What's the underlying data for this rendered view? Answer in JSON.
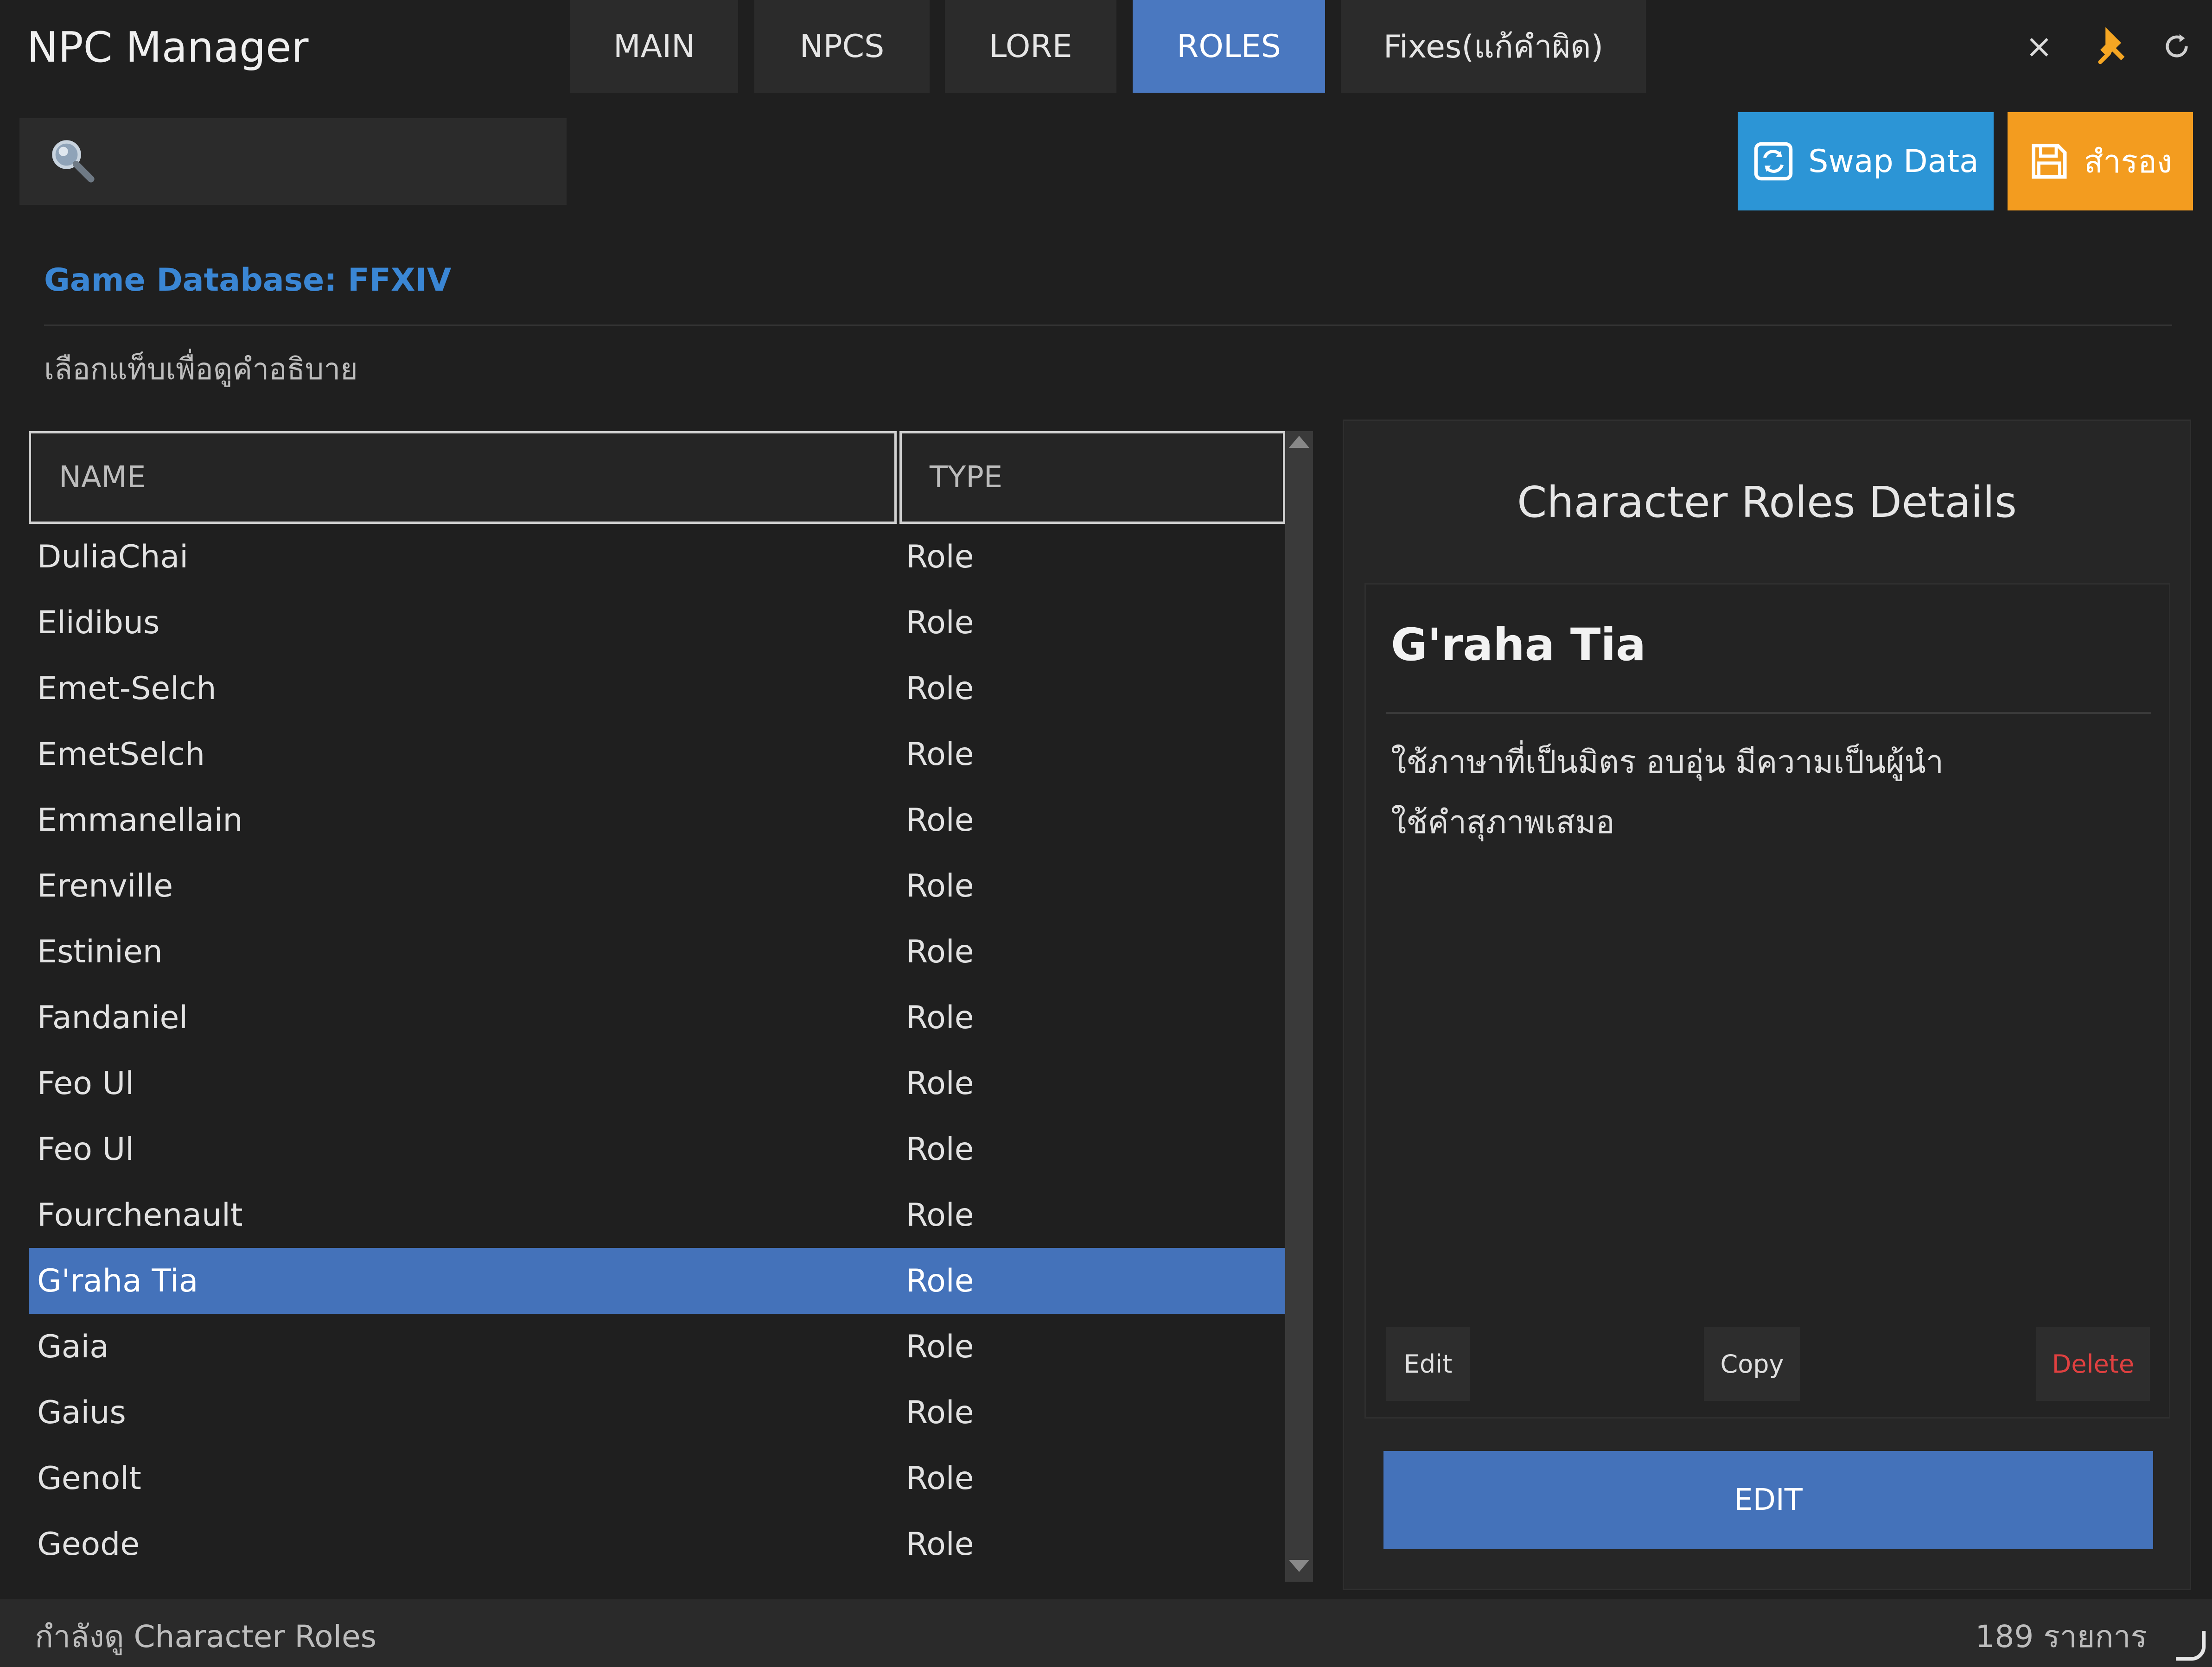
{
  "app": {
    "title": "NPC Manager"
  },
  "tabs": [
    {
      "label": "MAIN",
      "active": false
    },
    {
      "label": "NPCS",
      "active": false
    },
    {
      "label": "LORE",
      "active": false
    },
    {
      "label": "ROLES",
      "active": true
    },
    {
      "label": "Fixes(แก้คำผิด)",
      "active": false
    }
  ],
  "window": {
    "close": "×"
  },
  "search": {
    "placeholder": ""
  },
  "toolbar": {
    "swap_label": "Swap Data",
    "save_label": "สำรอง"
  },
  "database_label": "Game Database: FFXIV",
  "hint_text": "เลือกแท็บเพื่อดูคำอธิบาย",
  "table": {
    "headers": {
      "name": "NAME",
      "type": "TYPE"
    },
    "rows": [
      {
        "name": "DuliaChai",
        "type": "Role"
      },
      {
        "name": "Elidibus",
        "type": "Role"
      },
      {
        "name": "Emet-Selch",
        "type": "Role"
      },
      {
        "name": "EmetSelch",
        "type": "Role"
      },
      {
        "name": "Emmanellain",
        "type": "Role"
      },
      {
        "name": "Erenville",
        "type": "Role"
      },
      {
        "name": "Estinien",
        "type": "Role"
      },
      {
        "name": "Fandaniel",
        "type": "Role"
      },
      {
        "name": "Feo Ul",
        "type": "Role"
      },
      {
        "name": "Feo Ul",
        "type": "Role"
      },
      {
        "name": "Fourchenault",
        "type": "Role"
      },
      {
        "name": "G'raha Tia",
        "type": "Role"
      },
      {
        "name": "Gaia",
        "type": "Role"
      },
      {
        "name": "Gaius",
        "type": "Role"
      },
      {
        "name": "Genolt",
        "type": "Role"
      },
      {
        "name": "Geode",
        "type": "Role"
      }
    ],
    "selected_index": 11
  },
  "details": {
    "panel_title": "Character Roles Details",
    "name": "G'raha Tia",
    "description": "ใช้ภาษาที่เป็นมิตร อบอุ่น มีความเป็นผู้นำ\nใช้คำสุภาพเสมอ",
    "edit_label": "Edit",
    "copy_label": "Copy",
    "delete_label": "Delete",
    "edit_big_label": "EDIT"
  },
  "status": {
    "left": "กำลังดู Character Roles",
    "right": "189 รายการ"
  },
  "colors": {
    "accent": "#4472ba",
    "swap": "#2c95d6",
    "save": "#f39c1f",
    "danger": "#e04040",
    "link": "#3a86d4"
  }
}
